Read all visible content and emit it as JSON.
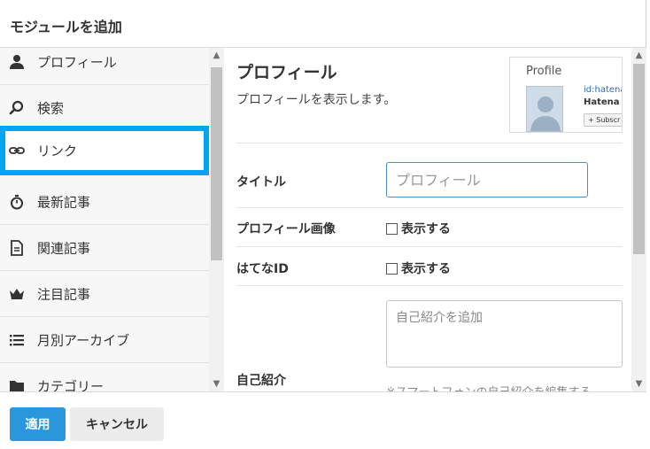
{
  "dialog": {
    "title": "モジュールを追加"
  },
  "sidebar": {
    "items": [
      {
        "label": "プロフィール",
        "icon": "person-icon"
      },
      {
        "label": "検索",
        "icon": "search-icon"
      },
      {
        "label": "リンク",
        "icon": "link-icon",
        "active": true
      },
      {
        "label": "最新記事",
        "icon": "stopwatch-icon"
      },
      {
        "label": "関連記事",
        "icon": "document-icon"
      },
      {
        "label": "注目記事",
        "icon": "crown-icon"
      },
      {
        "label": "月別アーカイブ",
        "icon": "list-icon"
      },
      {
        "label": "カテゴリー",
        "icon": "folder-icon"
      }
    ]
  },
  "main": {
    "module_title": "プロフィール",
    "module_description": "プロフィールを表示します。",
    "preview": {
      "label": "Profile",
      "id_text": "id:hatena",
      "name_text": "Hatena B",
      "subscribe_text": "+ Subscr"
    },
    "fields": {
      "title_label": "タイトル",
      "title_placeholder": "プロフィール",
      "image_label": "プロフィール画像",
      "image_checkbox_label": "表示する",
      "hatena_id_label": "はてなID",
      "hatena_id_checkbox_label": "表示する",
      "bio_label": "自己紹介",
      "bio_placeholder": "自己紹介を追加",
      "bio_note": "※スマートフォンの自己紹介を編集する"
    }
  },
  "footer": {
    "apply_label": "適用",
    "cancel_label": "キャンセル"
  },
  "colors": {
    "accent": "#00a6f0",
    "apply_button": "#2a96dc"
  }
}
